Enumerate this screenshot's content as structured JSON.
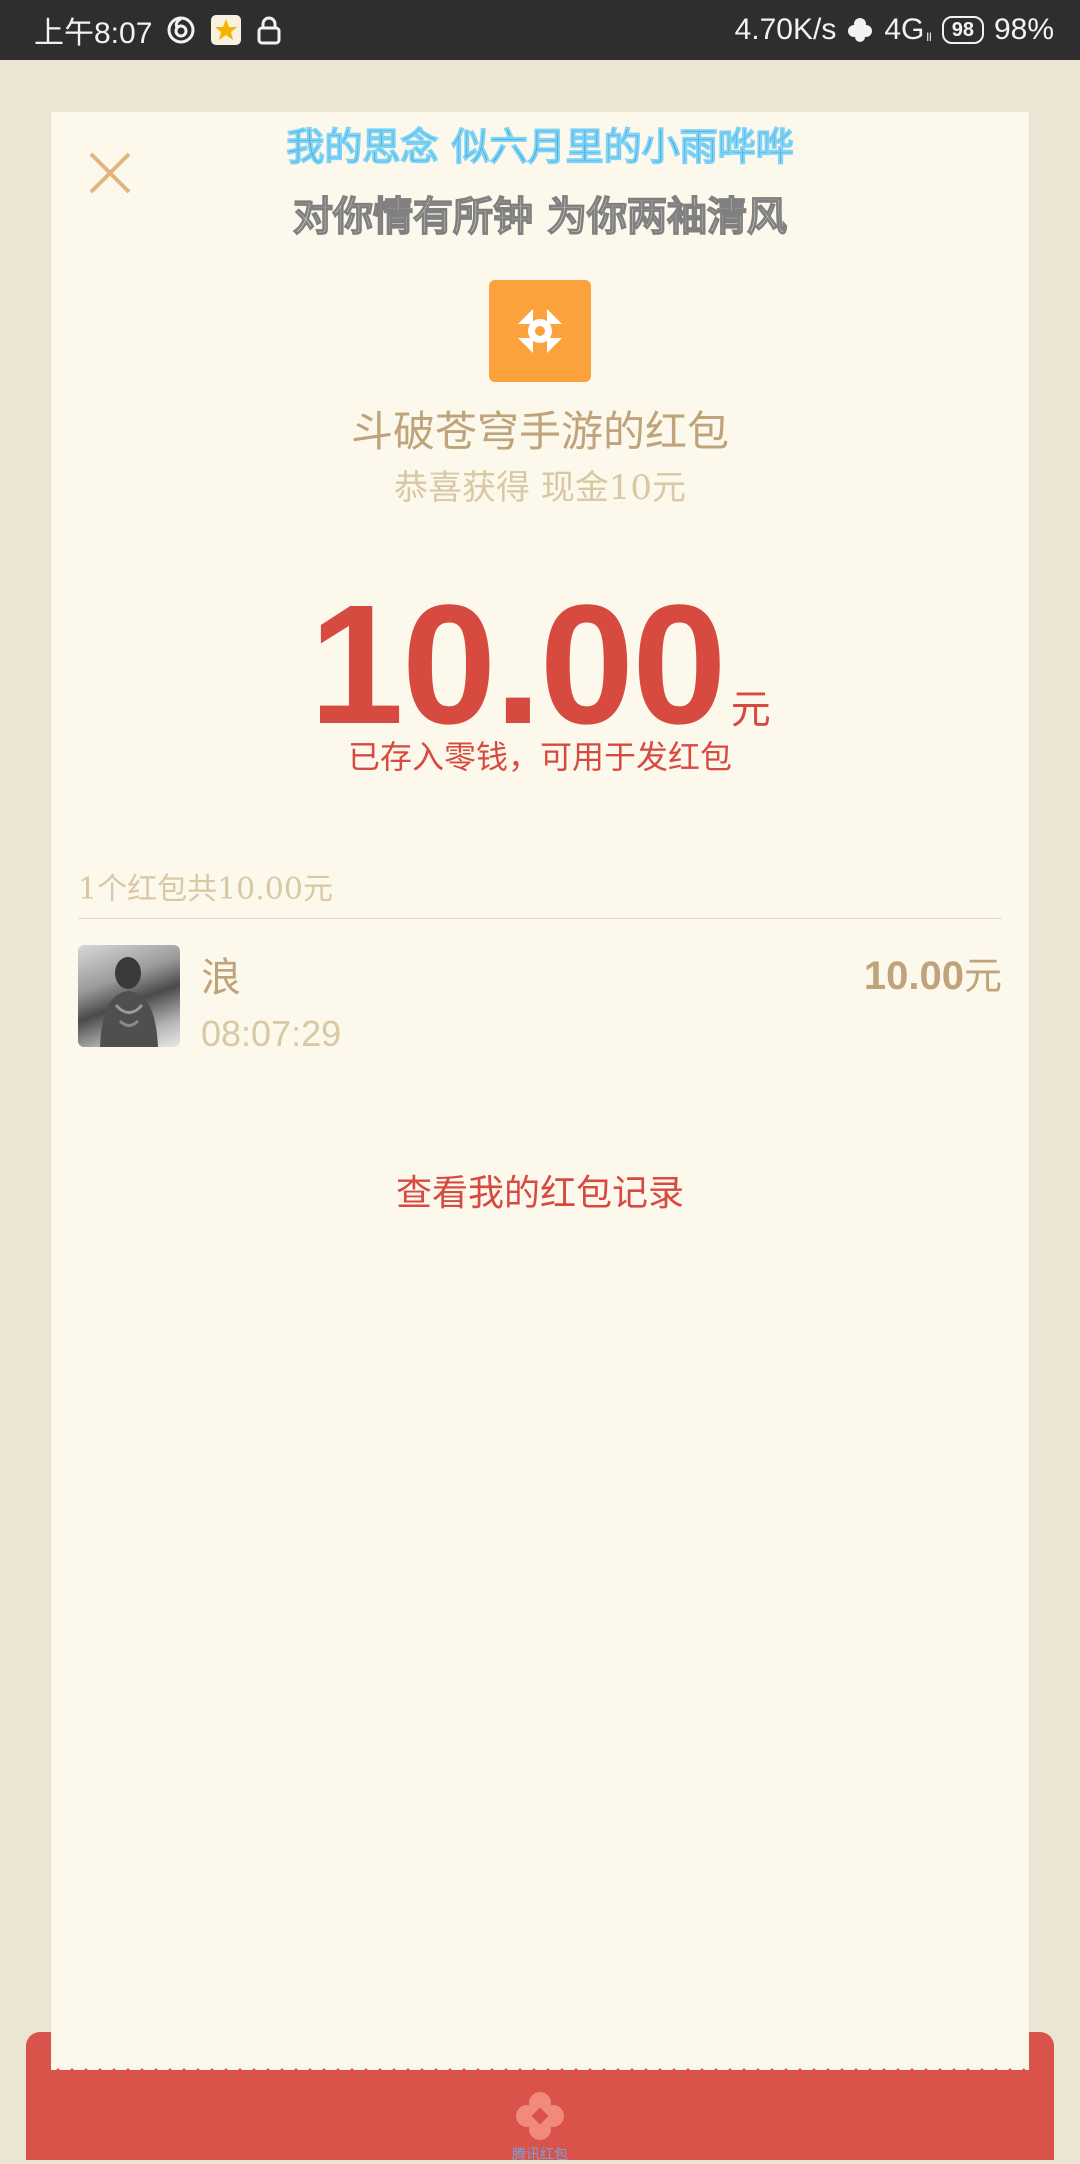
{
  "status_bar": {
    "time": "上午8:07",
    "net_speed": "4.70K/s",
    "network": "4G",
    "network_sub": "ll",
    "battery_badge": "98",
    "battery_percent": "98%"
  },
  "banner": {
    "line1": "我的思念 似六月里的小雨哗哗",
    "line2": "对你情有所钟  为你两袖清风"
  },
  "sender": {
    "title": "斗破苍穹手游的红包",
    "subtitle": "恭喜获得 现金10元"
  },
  "amount": {
    "value": "10.00",
    "unit": "元",
    "note": "已存入零钱，可用于发红包"
  },
  "summary": "1个红包共10.00元",
  "records": [
    {
      "name": "浪",
      "time": "08:07:29",
      "amount": "10.00",
      "unit": "元"
    }
  ],
  "history_link": "查看我的红包记录",
  "envelope": {
    "label": "腾讯红包"
  },
  "colors": {
    "accent_red": "#d64a40",
    "gold_text": "#bfa47b",
    "app_logo_orange": "#fca23d",
    "envelope_red": "#d9534a",
    "card_bg": "#fcf8ec"
  }
}
